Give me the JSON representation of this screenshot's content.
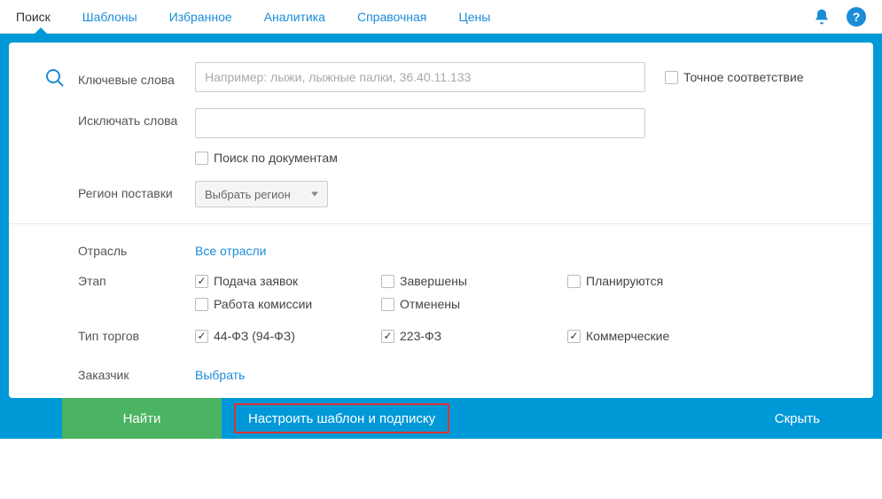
{
  "nav": {
    "items": [
      {
        "label": "Поиск",
        "active": true
      },
      {
        "label": "Шаблоны"
      },
      {
        "label": "Избранное"
      },
      {
        "label": "Аналитика"
      },
      {
        "label": "Справочная"
      },
      {
        "label": "Цены"
      }
    ]
  },
  "form": {
    "keywords_label": "Ключевые слова",
    "keywords_placeholder": "Например: лыжи, лыжные палки, 36.40.11.133",
    "exact_match_label": "Точное соответствие",
    "exclude_label": "Исключать слова",
    "search_docs_label": "Поиск по документам",
    "region_label": "Регион поставки",
    "region_button": "Выбрать регион",
    "industry_label": "Отрасль",
    "industry_link": "Все отрасли",
    "stage_label": "Этап",
    "stage_options": [
      {
        "label": "Подача заявок",
        "checked": true
      },
      {
        "label": "Завершены",
        "checked": false
      },
      {
        "label": "Планируются",
        "checked": false
      },
      {
        "label": "Работа комиссии",
        "checked": false
      },
      {
        "label": "Отменены",
        "checked": false
      }
    ],
    "type_label": "Тип торгов",
    "type_options": [
      {
        "label": "44-ФЗ (94-ФЗ)",
        "checked": true
      },
      {
        "label": "223-ФЗ",
        "checked": true
      },
      {
        "label": "Коммерческие",
        "checked": true
      }
    ],
    "customer_label": "Заказчик",
    "customer_link": "Выбрать"
  },
  "actions": {
    "find": "Найти",
    "configure": "Настроить шаблон и подписку",
    "hide": "Скрыть"
  }
}
